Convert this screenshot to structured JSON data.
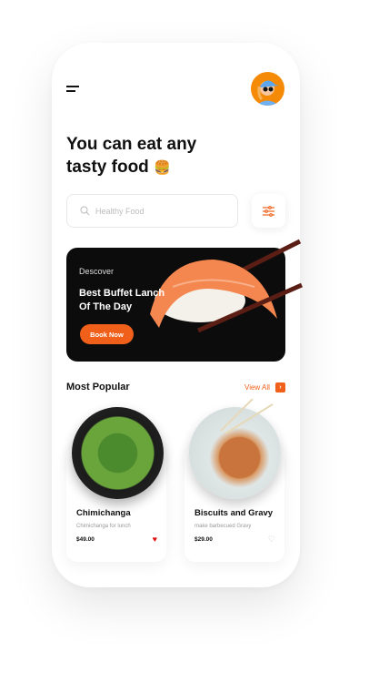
{
  "header": {
    "title_line1": "You can eat any",
    "title_line2": "tasty food",
    "emoji": "🍔"
  },
  "search": {
    "placeholder": "Healthy Food"
  },
  "banner": {
    "kicker": "Descover",
    "title_line1": "Best Buffet  Lanch",
    "title_line2": "Of The Day",
    "button": "Book Now"
  },
  "popular": {
    "title": "Most Popular",
    "view_all": "View All",
    "items": [
      {
        "name": "Chimichanga",
        "desc": "Chimichanga for lunch",
        "price": "$49.00",
        "favorite": true
      },
      {
        "name": "Biscuits and Gravy",
        "desc": "make barbecued Gravy",
        "price": "$29.00",
        "favorite": false
      }
    ]
  },
  "colors": {
    "accent": "#f0601a",
    "avatar_bg": "#f58a07"
  }
}
